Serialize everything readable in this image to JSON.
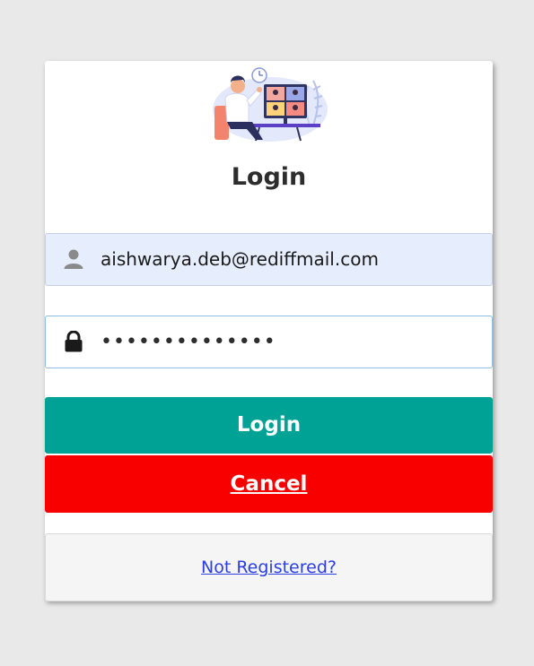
{
  "login_form": {
    "title": "Login",
    "email_value": "aishwarya.deb@rediffmail.com",
    "password_value": "••••••••••••••",
    "login_button_label": "Login",
    "cancel_button_label": "Cancel",
    "register_link_text": "Not Registered?",
    "icons": {
      "email": "user-icon",
      "password": "lock-icon"
    }
  },
  "colors": {
    "page_background": "#e9e9e9",
    "login_button": "#00a295",
    "cancel_button": "#f80000",
    "email_field_background": "#e6edfc",
    "link": "#2b3fdf"
  }
}
